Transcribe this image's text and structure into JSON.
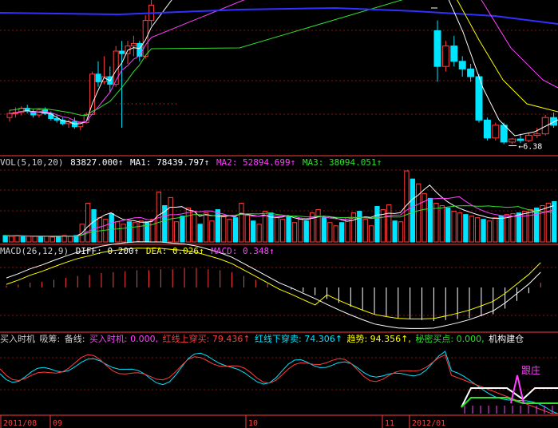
{
  "colors": {
    "up": "#ff3c3c",
    "down": "#00e5ff",
    "white": "#ffffff",
    "yellow": "#ffff00",
    "magenta": "#ff40ff",
    "green": "#30e030",
    "blue": "#3030ff",
    "grid": "#8a1010",
    "label": "#d0d0d0"
  },
  "price_panel": {
    "arrow_label": "6.38"
  },
  "vol_header": {
    "name": "VOL(5,10,20)",
    "vol": "83827.000↑",
    "ma1": "MA1: 78439.797↑",
    "ma2": "MA2: 52894.699↑",
    "ma3": "MA3: 38094.051↑"
  },
  "macd_header": {
    "name": "MACD(26,12,9)",
    "diff": "DIFF: 0.200↑",
    "dea": "DEA: 0.026↑",
    "macd": "MACD: 0.348↑"
  },
  "ind_header": {
    "name": "买入时机",
    "xichou": "吸筹:",
    "beixian": "备线:",
    "buy": "买入时机: 0.000,",
    "red_up": "红线上穿买: 79.436↑",
    "red_down": "红线下穿卖: 74.306↑",
    "trend": "趋势: 94.356↑,",
    "secret": "秘密买点: 0.000,",
    "inst": "机构建仓"
  },
  "ind_panel": {
    "annotation": "跟庄"
  },
  "date_axis": {
    "labels": [
      "2011/08",
      "09",
      "10",
      "11",
      "2012/01"
    ]
  },
  "chart_data": [
    {
      "type": "candlestick",
      "series": [
        {
          "name": "price",
          "values": [
            {
              "o": 6.9,
              "h": 7.05,
              "l": 6.82,
              "c": 6.98
            },
            {
              "o": 6.98,
              "h": 7.1,
              "l": 6.9,
              "c": 7.0
            },
            {
              "o": 7.0,
              "h": 7.12,
              "l": 6.94,
              "c": 7.08
            },
            {
              "o": 7.08,
              "h": 7.15,
              "l": 6.98,
              "c": 7.02
            },
            {
              "o": 7.02,
              "h": 7.06,
              "l": 6.9,
              "c": 6.95
            },
            {
              "o": 6.95,
              "h": 7.08,
              "l": 6.9,
              "c": 7.05
            },
            {
              "o": 7.05,
              "h": 7.1,
              "l": 6.95,
              "c": 6.98
            },
            {
              "o": 6.98,
              "h": 7.02,
              "l": 6.84,
              "c": 6.88
            },
            {
              "o": 6.88,
              "h": 6.95,
              "l": 6.8,
              "c": 6.85
            },
            {
              "o": 6.85,
              "h": 6.9,
              "l": 6.75,
              "c": 6.78
            },
            {
              "o": 6.78,
              "h": 6.86,
              "l": 6.7,
              "c": 6.82
            },
            {
              "o": 6.82,
              "h": 6.9,
              "l": 6.68,
              "c": 6.72
            },
            {
              "o": 6.72,
              "h": 6.82,
              "l": 6.65,
              "c": 6.8
            },
            {
              "o": 6.8,
              "h": 7.0,
              "l": 6.78,
              "c": 6.96
            },
            {
              "o": 6.96,
              "h": 7.8,
              "l": 6.95,
              "c": 7.75
            },
            {
              "o": 7.75,
              "h": 8.0,
              "l": 7.5,
              "c": 7.6
            },
            {
              "o": 7.6,
              "h": 8.1,
              "l": 7.55,
              "c": 7.7
            },
            {
              "o": 7.7,
              "h": 7.9,
              "l": 7.4,
              "c": 7.55
            },
            {
              "o": 7.55,
              "h": 8.3,
              "l": 7.5,
              "c": 8.2
            },
            {
              "o": 8.2,
              "h": 8.4,
              "l": 6.7,
              "c": 8.15
            },
            {
              "o": 8.15,
              "h": 8.4,
              "l": 7.95,
              "c": 8.3
            },
            {
              "o": 8.3,
              "h": 8.5,
              "l": 8.1,
              "c": 8.35
            },
            {
              "o": 8.35,
              "h": 8.4,
              "l": 8.0,
              "c": 8.1
            },
            {
              "o": 8.1,
              "h": 8.9,
              "l": 8.05,
              "c": 8.8
            },
            {
              "o": 8.8,
              "h": 9.2,
              "l": 8.7,
              "c": 9.1
            },
            {
              "o": 8.6,
              "h": 8.8,
              "l": 7.6,
              "c": 7.9
            },
            {
              "o": 7.9,
              "h": 8.4,
              "l": 7.8,
              "c": 8.3
            },
            {
              "o": 8.3,
              "h": 8.5,
              "l": 7.9,
              "c": 8.0
            },
            {
              "o": 8.0,
              "h": 8.1,
              "l": 7.7,
              "c": 7.85
            },
            {
              "o": 7.85,
              "h": 7.95,
              "l": 7.6,
              "c": 7.7
            },
            {
              "o": 7.7,
              "h": 7.75,
              "l": 6.8,
              "c": 6.85
            },
            {
              "o": 6.85,
              "h": 6.9,
              "l": 6.45,
              "c": 6.5
            },
            {
              "o": 6.5,
              "h": 6.8,
              "l": 6.45,
              "c": 6.75
            },
            {
              "o": 6.75,
              "h": 6.8,
              "l": 6.38,
              "c": 6.42
            },
            {
              "o": 6.42,
              "h": 6.5,
              "l": 6.38,
              "c": 6.48
            },
            {
              "o": 6.48,
              "h": 6.58,
              "l": 6.4,
              "c": 6.45
            },
            {
              "o": 6.45,
              "h": 6.6,
              "l": 6.42,
              "c": 6.55
            },
            {
              "o": 6.55,
              "h": 6.7,
              "l": 6.5,
              "c": 6.58
            },
            {
              "o": 6.58,
              "h": 6.95,
              "l": 6.55,
              "c": 6.9
            },
            {
              "o": 6.9,
              "h": 7.0,
              "l": 6.7,
              "c": 6.75
            }
          ]
        }
      ],
      "low_label_value": 6.38
    },
    {
      "type": "bar",
      "title": "VOL(5,10,20)",
      "series": [
        {
          "name": "VOL",
          "values": [
            8,
            7,
            8,
            7,
            7,
            7,
            7,
            7,
            6,
            7,
            8,
            7,
            8,
            22,
            48,
            40,
            30,
            28,
            35,
            25,
            22,
            25,
            24,
            26,
            25,
            28,
            62,
            45,
            55,
            25,
            32,
            42,
            38,
            22,
            36,
            26,
            40,
            32,
            28,
            30,
            48,
            33,
            26,
            22,
            38,
            36,
            30,
            28,
            32,
            24,
            28,
            26,
            36,
            40,
            30,
            24,
            20,
            24,
            30,
            36,
            38,
            28,
            20,
            44,
            40,
            46,
            26,
            25,
            88,
            78,
            72,
            60,
            54,
            48,
            45,
            42,
            38,
            36,
            34,
            32,
            30,
            28,
            26,
            30,
            32,
            34,
            35,
            36,
            38,
            40,
            42,
            45,
            48,
            50
          ]
        }
      ],
      "ma_labels": [
        "MA1",
        "MA2",
        "MA3"
      ]
    },
    {
      "type": "bar",
      "title": "MACD(26,12,9)",
      "series": [
        {
          "name": "MACD",
          "values": [
            0.02,
            0.03,
            0.05,
            0.06,
            0.08,
            0.1,
            0.12,
            0.13,
            0.15,
            0.16,
            0.17,
            0.18,
            0.18,
            0.19,
            0.19,
            0.2,
            0.2,
            0.19,
            0.18,
            0.16,
            0.12,
            0.08,
            0.04,
            0,
            -0.02,
            -0.05,
            -0.08,
            -0.12,
            -0.16,
            -0.2,
            -0.24,
            -0.28,
            -0.3,
            -0.32,
            -0.33,
            -0.34,
            -0.35,
            -0.34,
            -0.33,
            -0.32,
            -0.3,
            -0.28,
            -0.22,
            -0.14,
            -0.06,
            0.05
          ]
        },
        {
          "name": "DIFF"
        },
        {
          "name": "DEA"
        }
      ]
    },
    {
      "type": "line",
      "title": "买入时机",
      "series": [
        {
          "name": "红线上穿买"
        },
        {
          "name": "红线下穿卖"
        },
        {
          "name": "趋势"
        }
      ]
    }
  ]
}
